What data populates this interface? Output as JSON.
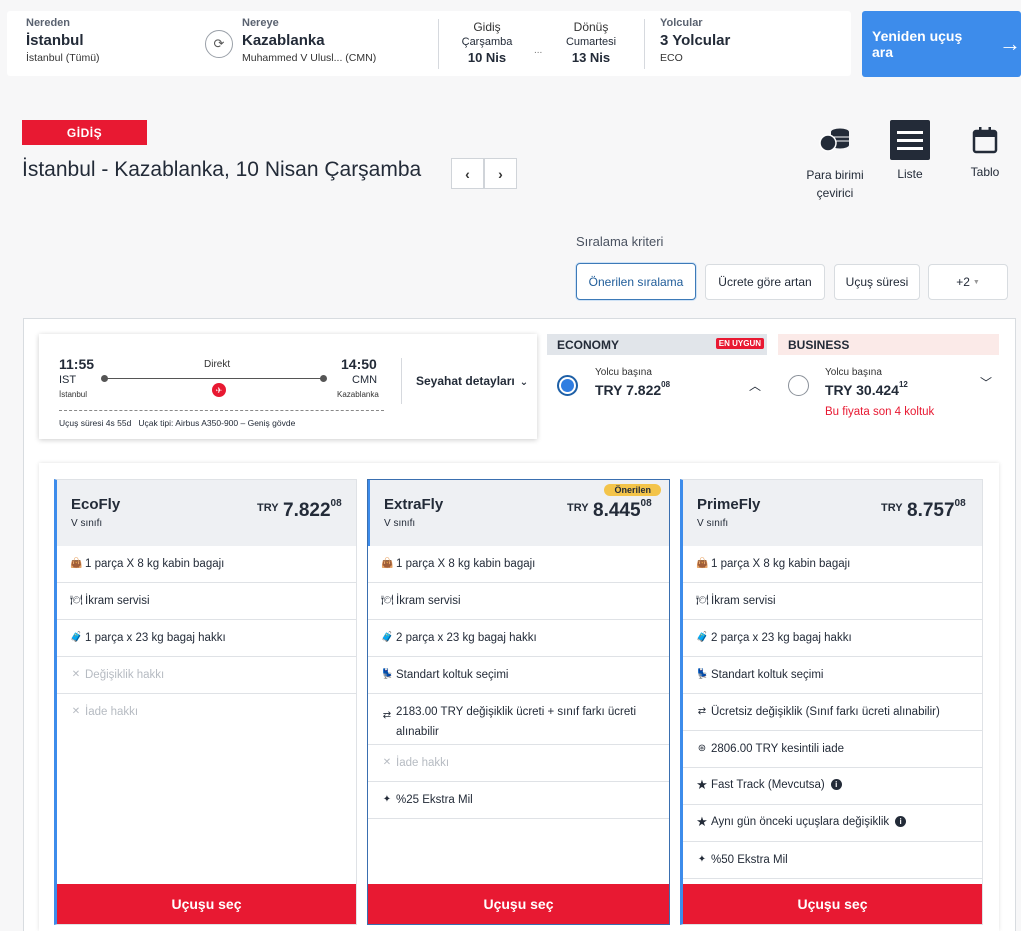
{
  "search": {
    "from_label": "Nereden",
    "from_city": "İstanbul",
    "from_sub": "İstanbul (Tümü)",
    "to_label": "Nereye",
    "to_city": "Kazablanka",
    "to_sub": "Muhammed V Ulusl...  (CMN)",
    "dep_label": "Gidiş",
    "dep_day": "Çarşamba",
    "dep_date": "10  Nis",
    "ret_label": "Dönüş",
    "ret_day": "Cumartesi",
    "ret_date": "13  Nis",
    "dots": "...",
    "pax_label": "Yolcular",
    "pax_value": "3 Yolcular",
    "pax_class": "ECO",
    "button": "Yeniden uçuş ara",
    "button_icon": "→"
  },
  "header": {
    "tag": "GİDİŞ",
    "title": "İstanbul - Kazablanka, 10 Nisan Çarşamba",
    "prev": "‹",
    "next": "›"
  },
  "tools": {
    "currency": "Para birimi çevirici",
    "list": "Liste",
    "table": "Tablo"
  },
  "sort": {
    "label": "Sıralama kriteri",
    "options": [
      "Önerilen sıralama",
      "Ücrete göre artan",
      "Uçuş süresi",
      "+2"
    ]
  },
  "flight": {
    "dep_time": "11:55",
    "dep_code": "IST",
    "dep_city": "İstanbul",
    "arr_time": "14:50",
    "arr_code": "CMN",
    "arr_city": "Kazablanka",
    "type": "Direkt",
    "details": "Seyahat detayları",
    "dur_label": "Uçuş süresi",
    "dur": "4s 55d",
    "plane_label": "Uçak tipi:",
    "plane": "Airbus A350-900",
    "body": "Geniş gövde"
  },
  "economy": {
    "name": "ECONOMY",
    "badge": "EN UYGUN",
    "per": "Yolcu başına",
    "cur": "TRY",
    "price": "7.822",
    "dec": "08"
  },
  "business": {
    "name": "BUSINESS",
    "per": "Yolcu başına",
    "cur": "TRY",
    "price": "30.424",
    "dec": "12",
    "note": "Bu fiyata son 4 koltuk"
  },
  "fares": [
    {
      "name": "EcoFly",
      "cls": "V sınıfı",
      "cur": "TRY",
      "price": "7.822",
      "dec": "08",
      "select": "Uçuşu seç",
      "features": [
        "1 parça X 8 kg kabin bagajı",
        "İkram servisi",
        "1 parça x 23 kg bagaj hakkı",
        "Değişiklik hakkı",
        "İade hakkı"
      ]
    },
    {
      "name": "ExtraFly",
      "cls": "V sınıfı",
      "cur": "TRY",
      "price": "8.445",
      "dec": "08",
      "badge": "Önerilen",
      "select": "Uçuşu seç",
      "features": [
        "1 parça X 8 kg kabin bagajı",
        "İkram servisi",
        "2 parça x 23 kg bagaj hakkı",
        "Standart koltuk seçimi",
        "2183.00 TRY değişiklik ücreti + sınıf farkı ücreti alınabilir",
        "İade hakkı",
        "%25 Ekstra Mil"
      ]
    },
    {
      "name": "PrimeFly",
      "cls": "V sınıfı",
      "cur": "TRY",
      "price": "8.757",
      "dec": "08",
      "select": "Uçuşu seç",
      "features": [
        "1 parça X 8 kg kabin bagajı",
        "İkram servisi",
        "2 parça x 23 kg bagaj hakkı",
        "Standart koltuk seçimi",
        "Ücretsiz değişiklik (Sınıf farkı ücreti alınabilir)",
        "2806.00 TRY kesintili iade",
        "Fast Track (Mevcutsa)",
        "Aynı gün önceki uçuşlara değişiklik",
        "%50 Ekstra Mil"
      ]
    }
  ],
  "colors": {
    "accent": "#e81932",
    "blue": "#3d8ceb",
    "dark": "#232b38"
  }
}
